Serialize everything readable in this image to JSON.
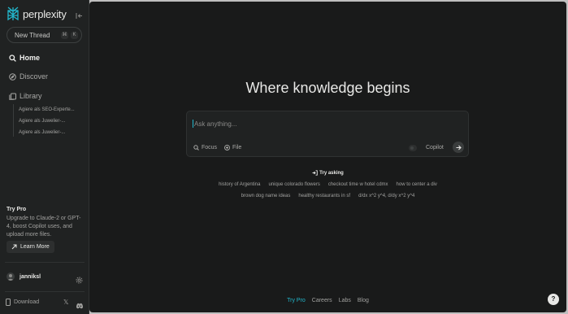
{
  "app": {
    "name": "perplexity"
  },
  "sidebar": {
    "new_thread_label": "New Thread",
    "shortcut_keys": [
      "⌘",
      "K"
    ],
    "nav": [
      {
        "label": "Home",
        "icon": "search-icon",
        "active": true
      },
      {
        "label": "Discover",
        "icon": "compass-icon",
        "active": false
      },
      {
        "label": "Library",
        "icon": "library-icon",
        "active": false
      }
    ],
    "library_items": [
      "Agiere als SEO-Experte...",
      "Agiere als Juwelier-...",
      "Agiere als Juwelier-..."
    ],
    "try_pro": {
      "title": "Try Pro",
      "text": "Upgrade to Claude-2 or GPT-4, boost Copilot uses, and upload more files.",
      "button_label": "Learn More"
    },
    "user": {
      "name": "janniksl"
    },
    "download_label": "Download",
    "social": [
      "𝕏",
      "discord"
    ]
  },
  "main": {
    "headline": "Where knowledge begins",
    "search": {
      "placeholder": "Ask anything...",
      "focus_label": "Focus",
      "file_label": "File",
      "copilot_label": "Copilot",
      "copilot_enabled": false
    },
    "try_asking_label": "Try asking",
    "suggestions_row1": [
      "history of Argentina",
      "unique colorado flowers",
      "checkout time w hotel cdmx",
      "how to center a div"
    ],
    "suggestions_row2": [
      "brown dog name ideas",
      "healthy restaurants in sf",
      "d/dx x^2 y^4, d/dy x^2 y^4"
    ],
    "footer_links": [
      "Try Pro",
      "Careers",
      "Labs",
      "Blog"
    ],
    "help_label": "?"
  },
  "colors": {
    "sidebar_bg": "#202222",
    "main_bg": "#191a1a",
    "accent": "#22b8cd",
    "text": "#e8e8e6",
    "muted": "#a2a2a0"
  }
}
